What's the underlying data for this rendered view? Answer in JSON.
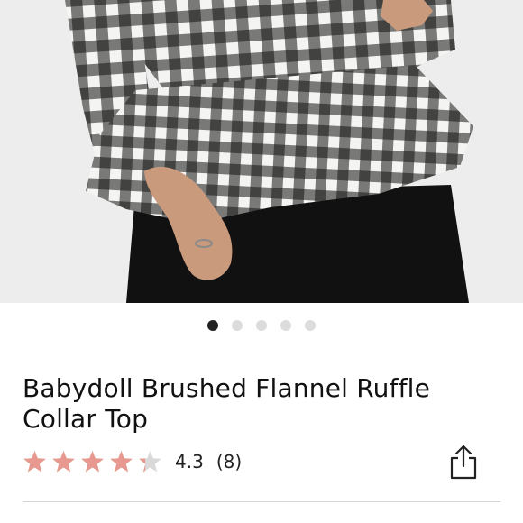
{
  "product": {
    "image": {
      "description_icon": "product-photo",
      "carousel": {
        "total": 5,
        "active_index": 0
      }
    },
    "title": "Babydoll Brushed Flannel Ruffle Collar Top",
    "rating": {
      "value_text": "4.3",
      "value": 4.3,
      "max": 5,
      "reviews_text": "(8)",
      "star_color": "#e8998f",
      "empty_star_color": "#d9d9d9"
    },
    "share": {
      "icon": "share-icon"
    }
  },
  "colors": {
    "gingham_dark": "#141414",
    "gingham_light": "#f4f4f2",
    "pants": "#111111",
    "skin": "#c99a7c",
    "backdrop": "#ededed",
    "active_dot": "#222222",
    "inactive_dot": "#dcdcdc"
  }
}
